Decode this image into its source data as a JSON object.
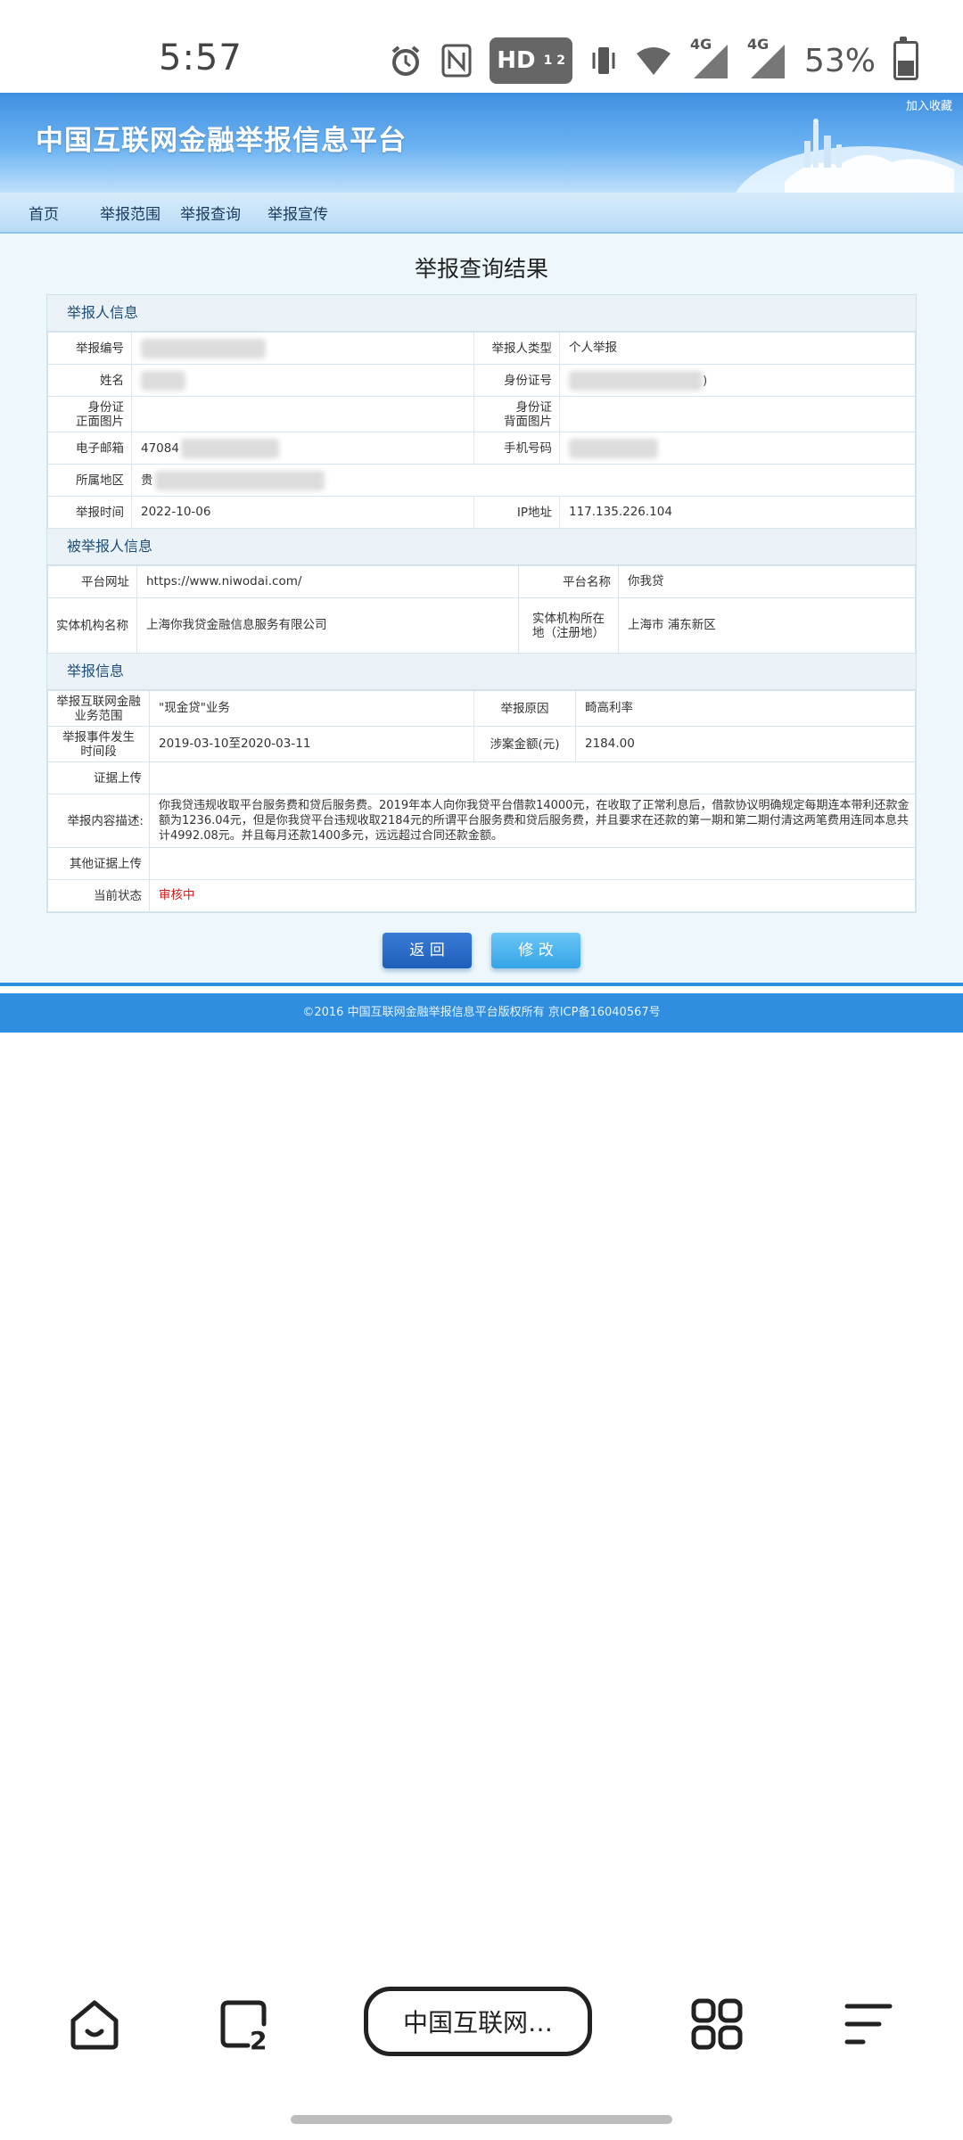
{
  "status_bar": {
    "time": "5:57",
    "hd": "HD",
    "hd_sub": "1 2",
    "sim1": "4G",
    "sim2": "4G",
    "battery": "53%",
    "battery_level": 0.53,
    "icons": [
      "alarm-icon",
      "nfc-icon",
      "hd-icon",
      "vibrate-icon",
      "wifi-icon",
      "signal-icon",
      "signal-icon",
      "battery-icon"
    ]
  },
  "banner": {
    "title": "中国互联网金融举报信息平台",
    "favorite_link": "加入收藏"
  },
  "nav": {
    "items": [
      "首页",
      "举报范围",
      "举报查询",
      "举报宣传"
    ]
  },
  "page_title": "举报查询结果",
  "reporter": {
    "section_title": "举报人信息",
    "id_label": "举报编号",
    "id_value": "2...",
    "type_label": "举报人类型",
    "type_value": "个人举报",
    "name_label": "姓名",
    "idcard_label": "身份证号",
    "idcard_tail": ")",
    "front_label": "身份证\n正面图片",
    "back_label": "身份证\n背面图片",
    "email_label": "电子邮箱",
    "email_value": "47084",
    "phone_label": "手机号码",
    "region_label": "所属地区",
    "region_value": "贵",
    "time_label": "举报时间",
    "time_value": "2022-10-06",
    "ip_label": "IP地址",
    "ip_value": "117.135.226.104"
  },
  "reported": {
    "section_title": "被举报人信息",
    "site_label": "平台网址",
    "site_value": "https://www.niwodai.com/",
    "platform_label": "平台名称",
    "platform_value": "你我贷",
    "entity_label": "实体机构名称",
    "entity_value": "上海你我贷金融信息服务有限公司",
    "location_label": "实体机构所在地（注册地）",
    "location_value": "上海市 浦东新区"
  },
  "report": {
    "section_title": "举报信息",
    "scope_label": "举报互联网金融业务范围",
    "scope_value": "\"现金贷\"业务",
    "reason_label": "举报原因",
    "reason_value": "畸高利率",
    "period_label": "举报事件发生时间段",
    "period_value": "2019-03-10至2020-03-11",
    "amount_label": "涉案金额(元)",
    "amount_value": "2184.00",
    "evidence_label": "证据上传",
    "content_label": "举报内容描述:",
    "content_value": "你我贷违规收取平台服务费和贷后服务费。2019年本人向你我贷平台借款14000元，在收取了正常利息后，借款协议明确规定每期连本带利还款金额为1236.04元，但是你我贷平台违规收取2184元的所谓平台服务费和贷后服务费，并且要求在还款的第一期和第二期付清这两笔费用连同本息共计4992.08元。并且每月还款1400多元，远远超过合同还款金额。",
    "other_evidence_label": "其他证据上传",
    "status_label": "当前状态",
    "status_value": "审核中"
  },
  "buttons": {
    "back": "返 回",
    "edit": "修 改"
  },
  "footer": "©2016 中国互联网金融举报信息平台版权所有 京ICP备16040567号",
  "browser_bar": {
    "url_label": "中国互联网…",
    "icons": [
      "home-icon",
      "tabs-icon",
      "apps-icon",
      "menu-icon"
    ],
    "tab_count": "2"
  },
  "colors": {
    "banner_blue": "#3f8fe0",
    "footer_blue": "#2f8ee0",
    "status_red": "#d21a1a",
    "button_back": "#1f5fbc",
    "button_edit": "#34a4e6"
  }
}
